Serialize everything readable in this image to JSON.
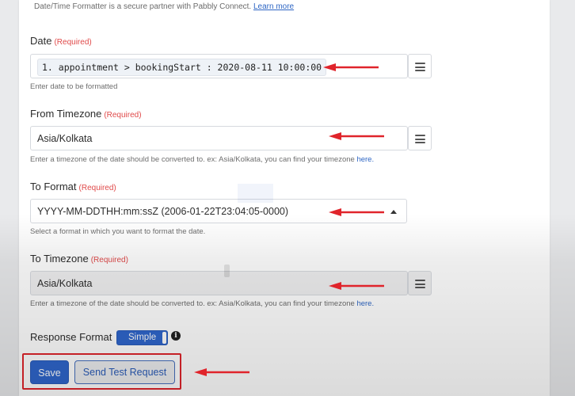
{
  "header": {
    "partner_text": "Date/Time Formatter is a secure partner with Pabbly Connect.",
    "partner_link": "Learn more"
  },
  "date": {
    "label": "Date",
    "required": "(Required)",
    "value": "1. appointment > bookingStart : 2020-08-11 10:00:00",
    "help": "Enter date to be formatted"
  },
  "from_tz": {
    "label": "From Timezone",
    "required": "(Required)",
    "value": "Asia/Kolkata",
    "help": "Enter a timezone of the date should be converted to. ex: Asia/Kolkata, you can find your timezone",
    "help_link": "here."
  },
  "to_format": {
    "label": "To Format",
    "required": "(Required)",
    "value": "YYYY-MM-DDTHH:mm:ssZ (2006-01-22T23:04:05-0000)",
    "help": "Select a format in which you want to format the date."
  },
  "to_tz": {
    "label": "To Timezone",
    "required": "(Required)",
    "value": "Asia/Kolkata",
    "help": "Enter a timezone of the date should be converted to. ex: Asia/Kolkata, you can find your timezone",
    "help_link": "here."
  },
  "response_format": {
    "label": "Response Format",
    "toggle_value": "Simple"
  },
  "actions": {
    "save": "Save",
    "send_test": "Send Test Request"
  },
  "colors": {
    "accent": "#2f66cc",
    "annotation_red": "#e0242b",
    "required_red": "#e04a4a"
  },
  "icons": [
    "menu-icon",
    "caret-up-icon",
    "info-icon",
    "red-arrow-annotation"
  ]
}
